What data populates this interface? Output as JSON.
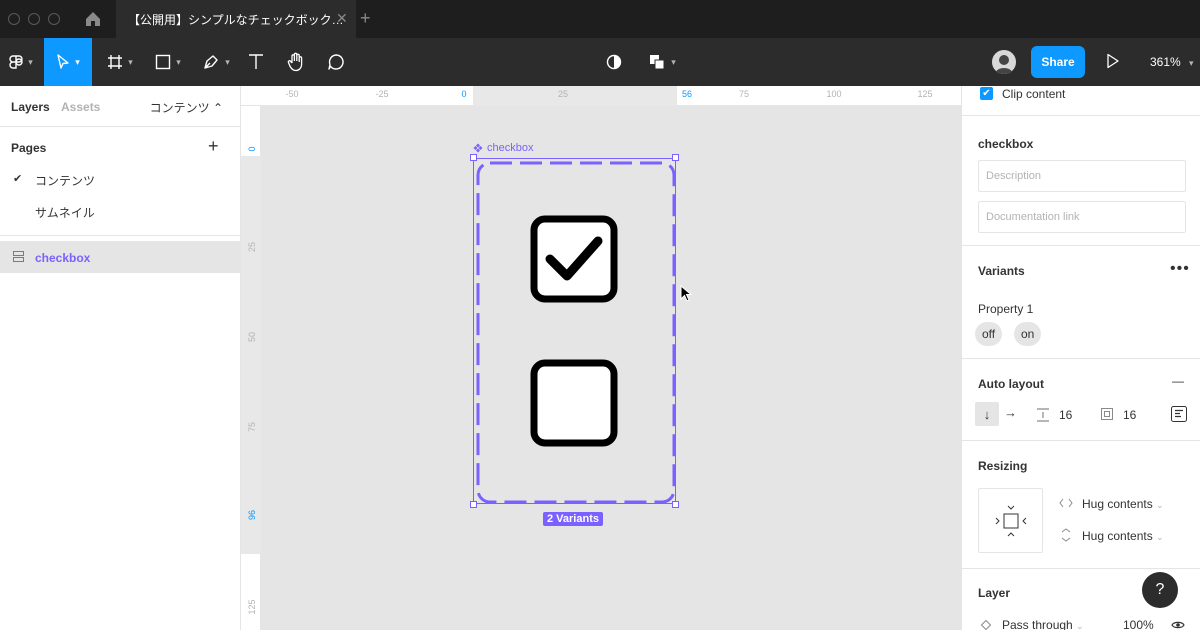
{
  "titlebar": {
    "tab_title": "【公開用】シンプルなチェックボック…",
    "close": "✕",
    "new_tab": "+"
  },
  "toolbar": {
    "share_label": "Share",
    "zoom": "361%"
  },
  "left_panel": {
    "tab_layers": "Layers",
    "tab_assets": "Assets",
    "current_page_selector": "コンテンツ ⌃",
    "pages_title": "Pages",
    "pages_add": "+",
    "pages": [
      {
        "label": "コンテンツ",
        "checked": true
      },
      {
        "label": "サムネイル",
        "checked": false
      }
    ],
    "check_mark": "✔",
    "layers": [
      {
        "label": "checkbox",
        "selected": true
      }
    ]
  },
  "rulers": {
    "top": [
      "-50",
      "-25",
      "0",
      "25",
      "56",
      "75",
      "100",
      "125"
    ],
    "top_highlight": [
      "0",
      "56"
    ],
    "left": [
      "0",
      "25",
      "50",
      "75",
      "96",
      "125"
    ],
    "left_highlight": [
      "0",
      "96"
    ]
  },
  "canvas": {
    "frame_label": "checkbox",
    "variants_badge": "2 Variants",
    "variants": [
      {
        "state": "on",
        "checked": true
      },
      {
        "state": "off",
        "checked": false
      }
    ]
  },
  "right_panel": {
    "clip_content_label": "Clip content",
    "clip_content_checked": true,
    "component_name": "checkbox",
    "description_placeholder": "Description",
    "doc_link_placeholder": "Documentation link",
    "variants_heading": "Variants",
    "more": "•••",
    "property_label": "Property 1",
    "property_values": [
      "off",
      "on"
    ],
    "auto_layout_heading": "Auto layout",
    "auto_layout_remove": "—",
    "direction_vertical": "↓",
    "direction_horizontal": "→",
    "spacing_between": "16",
    "padding": "16",
    "resizing_heading": "Resizing",
    "width_mode": "Hug contents",
    "height_mode": "Hug contents",
    "layer_heading": "Layer",
    "blend_mode": "Pass through",
    "opacity": "100%",
    "help": "?"
  },
  "colors": {
    "accent_blue": "#0d99ff",
    "component_purple": "#7b61ff",
    "toolbar_dark": "#2c2c2c"
  }
}
